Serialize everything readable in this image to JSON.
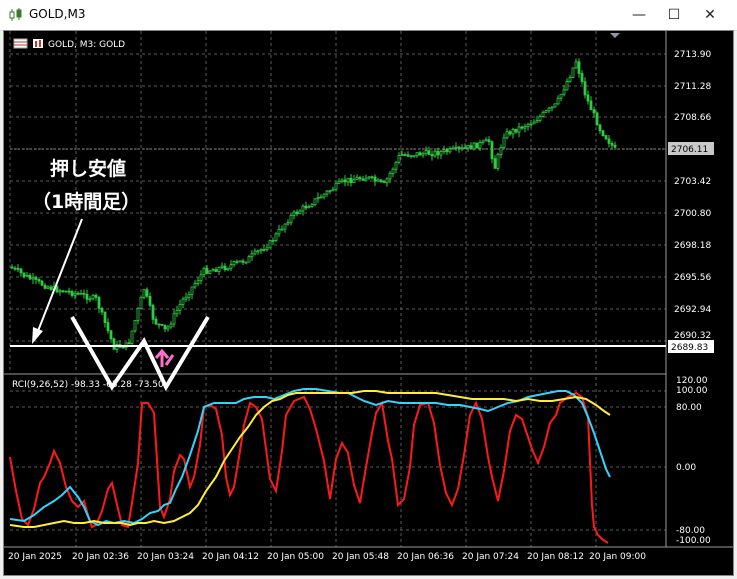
{
  "window": {
    "title": "GOLD,M3",
    "buttons": {
      "minimize": "—",
      "maximize": "☐",
      "close": "✕"
    }
  },
  "chart": {
    "header": "GOLD, M3: GOLD",
    "price_axis": [
      "2713.90",
      "2711.28",
      "2708.66",
      "2706.11",
      "2703.42",
      "2700.80",
      "2698.18",
      "2695.56",
      "2692.94",
      "2690.32"
    ],
    "current_price": "2706.11",
    "hline_label": "2689.83",
    "time_axis": [
      "20 Jan 2025",
      "20 Jan 02:36",
      "20 Jan 03:24",
      "20 Jan 04:12",
      "20 Jan 05:00",
      "20 Jan 05:48",
      "20 Jan 06:36",
      "20 Jan 07:24",
      "20 Jan 08:12",
      "20 Jan 09:00"
    ],
    "colors": {
      "background": "#000000",
      "bull": "#2ecc40",
      "bear": "#2ecc40",
      "grid": "#5a5a5a",
      "rci_short": "#ff1a1a",
      "rci_mid": "#2fd4ff",
      "rci_long": "#ffee33"
    }
  },
  "annotation": {
    "line1": "押し安値",
    "line2": "（1時間足）"
  },
  "indicator": {
    "label": "RCI(9,26,52) -98.33 -63.28 -73.50",
    "levels": [
      "120.00",
      "100.00",
      "80.00",
      "0.00",
      "-80.00",
      "-100.00"
    ]
  }
}
